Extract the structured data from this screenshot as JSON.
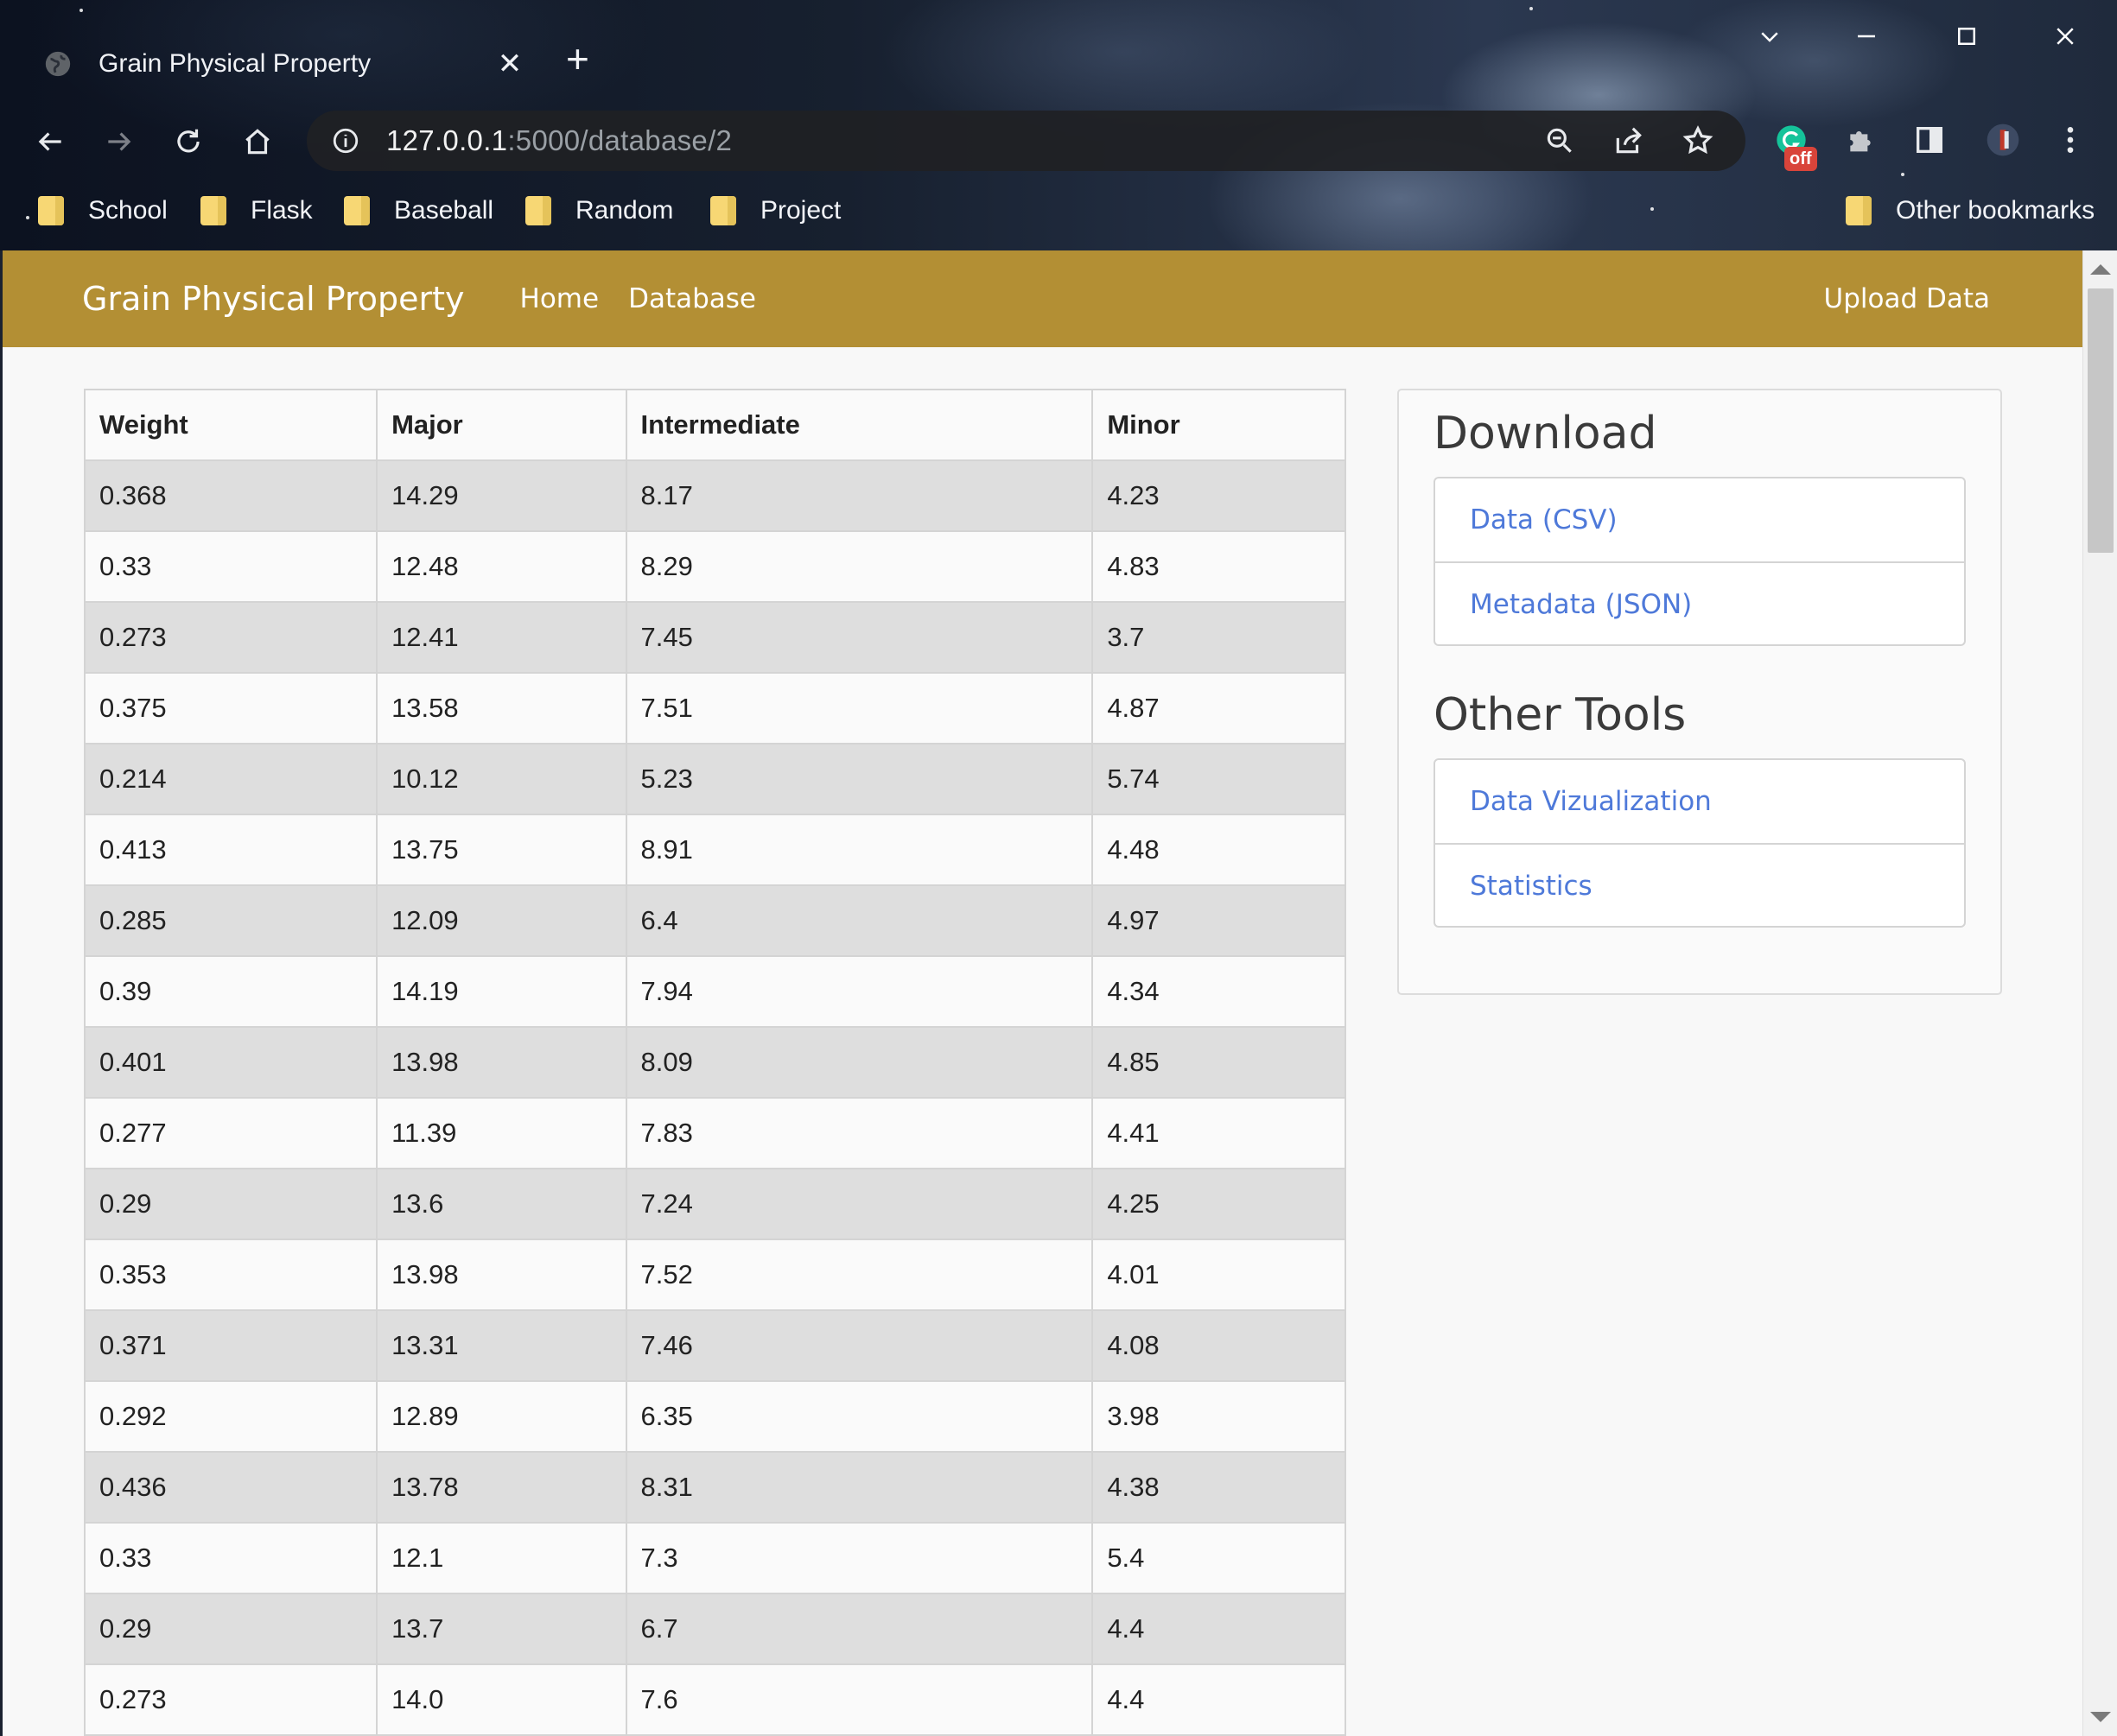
{
  "browser": {
    "tab_title": "Grain Physical Property",
    "url_host": "127.0.0.1",
    "url_path": ":5000/database/2",
    "extension_badge": "off",
    "bookmarks": [
      "School",
      "Flask",
      "Baseball",
      "Random",
      "Project"
    ],
    "other_bookmarks": "Other bookmarks",
    "icons": [
      "globe-icon",
      "close-icon",
      "plus-icon",
      "back-icon",
      "forward-icon",
      "reload-icon",
      "home-icon",
      "info-icon",
      "zoom-icon",
      "share-icon",
      "star-icon",
      "grammarly-icon",
      "puzzle-icon",
      "sidepanel-icon",
      "profile-avatar",
      "kebab-menu-icon",
      "chevron-down-icon",
      "minimize-icon",
      "maximize-icon",
      "window-close-icon"
    ]
  },
  "navbar": {
    "brand": "Grain Physical Property",
    "links": [
      "Home",
      "Database"
    ],
    "upload": "Upload Data",
    "color": "#b38f34"
  },
  "table": {
    "headers": [
      "Weight",
      "Major",
      "Intermediate",
      "Minor"
    ],
    "rows": [
      [
        "0.368",
        "14.29",
        "8.17",
        "4.23"
      ],
      [
        "0.33",
        "12.48",
        "8.29",
        "4.83"
      ],
      [
        "0.273",
        "12.41",
        "7.45",
        "3.7"
      ],
      [
        "0.375",
        "13.58",
        "7.51",
        "4.87"
      ],
      [
        "0.214",
        "10.12",
        "5.23",
        "5.74"
      ],
      [
        "0.413",
        "13.75",
        "8.91",
        "4.48"
      ],
      [
        "0.285",
        "12.09",
        "6.4",
        "4.97"
      ],
      [
        "0.39",
        "14.19",
        "7.94",
        "4.34"
      ],
      [
        "0.401",
        "13.98",
        "8.09",
        "4.85"
      ],
      [
        "0.277",
        "11.39",
        "7.83",
        "4.41"
      ],
      [
        "0.29",
        "13.6",
        "7.24",
        "4.25"
      ],
      [
        "0.353",
        "13.98",
        "7.52",
        "4.01"
      ],
      [
        "0.371",
        "13.31",
        "7.46",
        "4.08"
      ],
      [
        "0.292",
        "12.89",
        "6.35",
        "3.98"
      ],
      [
        "0.436",
        "13.78",
        "8.31",
        "4.38"
      ],
      [
        "0.33",
        "12.1",
        "7.3",
        "5.4"
      ],
      [
        "0.29",
        "13.7",
        "6.7",
        "4.4"
      ],
      [
        "0.273",
        "14.0",
        "7.6",
        "4.4"
      ]
    ]
  },
  "sidebar": {
    "download_title": "Download",
    "download_links": [
      "Data (CSV)",
      "Metadata (JSON)"
    ],
    "tools_title": "Other Tools",
    "tools_links": [
      "Data Vizualization",
      "Statistics"
    ],
    "link_color": "#4e79d9"
  }
}
